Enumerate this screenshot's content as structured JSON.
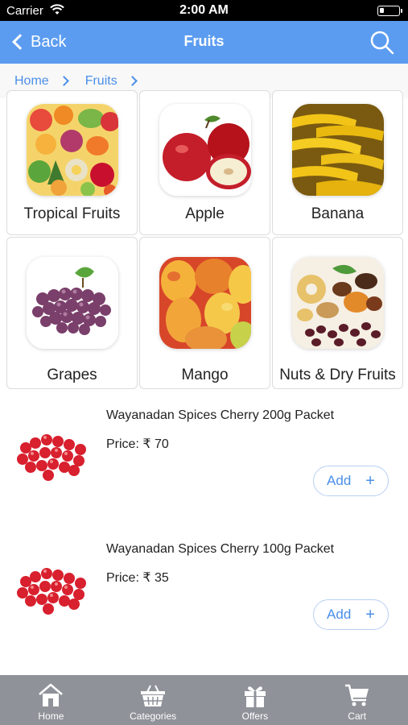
{
  "status_bar": {
    "carrier": "Carrier",
    "time": "2:00 AM"
  },
  "nav": {
    "back_label": "Back",
    "title": "Fruits"
  },
  "breadcrumb": [
    {
      "label": "Home"
    },
    {
      "label": "Fruits"
    }
  ],
  "categories": [
    {
      "label": "Tropical Fruits"
    },
    {
      "label": "Apple"
    },
    {
      "label": "Banana"
    },
    {
      "label": "Grapes"
    },
    {
      "label": "Mango"
    },
    {
      "label": "Nuts & Dry Fruits"
    }
  ],
  "products": [
    {
      "name": "Wayanadan Spices Cherry 200g Packet",
      "price": "Price: ₹ 70",
      "add_label": "Add"
    },
    {
      "name": "Wayanadan Spices Cherry 100g Packet",
      "price": "Price: ₹ 35",
      "add_label": "Add"
    }
  ],
  "tabs": [
    {
      "label": "Home",
      "icon": "home-icon"
    },
    {
      "label": "Categories",
      "icon": "basket-icon"
    },
    {
      "label": "Offers",
      "icon": "gift-icon"
    },
    {
      "label": "Cart",
      "icon": "cart-icon"
    }
  ],
  "colors": {
    "nav": "#5b9cf0",
    "accent": "#4a8fe7",
    "tab_bar": "#8f9299"
  }
}
